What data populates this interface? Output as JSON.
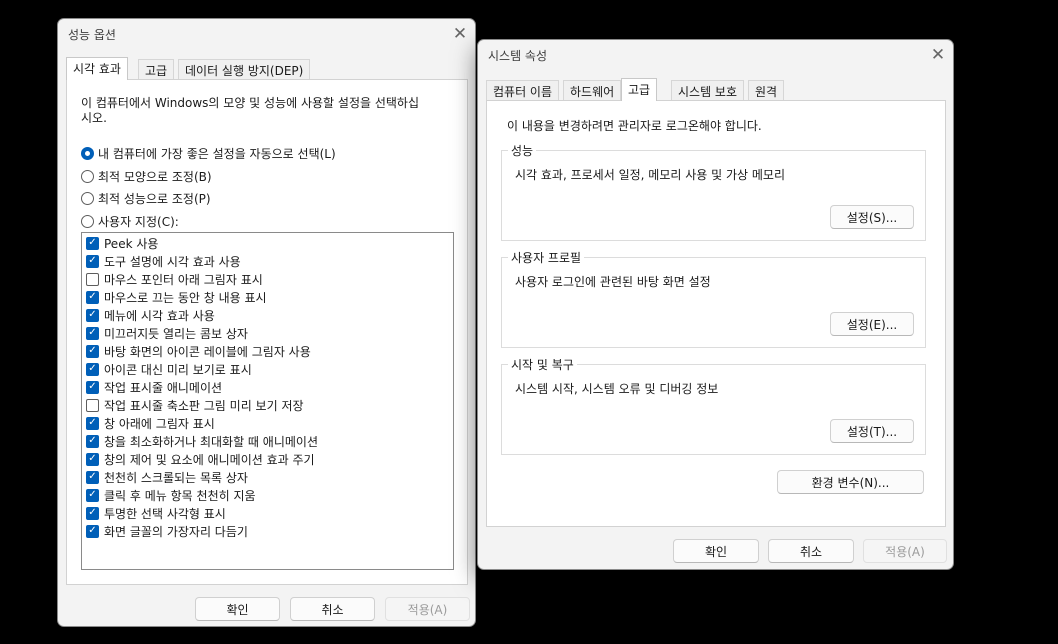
{
  "perf": {
    "title": "성능 옵션",
    "tabs": [
      "시각 효과",
      "고급",
      "데이터 실행 방지(DEP)"
    ],
    "intro": [
      "이 컴퓨터에서 Windows의 모양 및 성능에 사용할 설정을 선택하십",
      "시오."
    ],
    "options": [
      {
        "label": "내 컴퓨터에 가장 좋은 설정을 자동으로 선택(L)",
        "selected": true
      },
      {
        "label": "최적 모양으로 조정(B)",
        "selected": false
      },
      {
        "label": "최적 성능으로 조정(P)",
        "selected": false
      },
      {
        "label": "사용자 지정(C):",
        "selected": false
      }
    ],
    "effects": [
      {
        "label": "Peek 사용",
        "checked": true
      },
      {
        "label": "도구 설명에 시각 효과 사용",
        "checked": true
      },
      {
        "label": "마우스 포인터 아래 그림자 표시",
        "checked": false
      },
      {
        "label": "마우스로 끄는 동안 창 내용 표시",
        "checked": true
      },
      {
        "label": "메뉴에 시각 효과 사용",
        "checked": true
      },
      {
        "label": "미끄러지듯 열리는 콤보 상자",
        "checked": true
      },
      {
        "label": "바탕 화면의 아이콘 레이블에 그림자 사용",
        "checked": true
      },
      {
        "label": "아이콘 대신 미리 보기로 표시",
        "checked": true
      },
      {
        "label": "작업 표시줄 애니메이션",
        "checked": true
      },
      {
        "label": "작업 표시줄 축소판 그림 미리 보기 저장",
        "checked": false
      },
      {
        "label": "창 아래에 그림자 표시",
        "checked": true
      },
      {
        "label": "창을 최소화하거나 최대화할 때 애니메이션",
        "checked": true
      },
      {
        "label": "창의 제어 및 요소에 애니메이션 효과 주기",
        "checked": true
      },
      {
        "label": "천천히 스크롤되는 목록 상자",
        "checked": true
      },
      {
        "label": "클릭 후 메뉴 항목 천천히 지움",
        "checked": true
      },
      {
        "label": "투명한 선택 사각형 표시",
        "checked": true
      },
      {
        "label": "화면 글꼴의 가장자리 다듬기",
        "checked": true
      }
    ],
    "ok": "확인",
    "cancel": "취소",
    "apply": "적용(A)"
  },
  "sys": {
    "title": "시스템 속성",
    "tabs": [
      "컴퓨터 이름",
      "하드웨어",
      "고급",
      "시스템 보호",
      "원격"
    ],
    "admin_note": "이 내용을 변경하려면 관리자로 로그온해야 합니다.",
    "groups": [
      {
        "label": "성능",
        "desc": "시각 효과, 프로세서 일정, 메모리 사용 및 가상 메모리",
        "button": "설정(S)..."
      },
      {
        "label": "사용자 프로필",
        "desc": "사용자 로그인에 관련된 바탕 화면 설정",
        "button": "설정(E)..."
      },
      {
        "label": "시작 및 복구",
        "desc": "시스템 시작, 시스템 오류 및 디버깅 정보",
        "button": "설정(T)..."
      }
    ],
    "env_button": "환경 변수(N)...",
    "ok": "확인",
    "cancel": "취소",
    "apply": "적용(A)"
  },
  "icons": {
    "close": "close-icon",
    "check": "check-icon"
  },
  "colors": {
    "accent": "#005fb8",
    "window": "#f3f3f3",
    "desktop": "#000000"
  }
}
